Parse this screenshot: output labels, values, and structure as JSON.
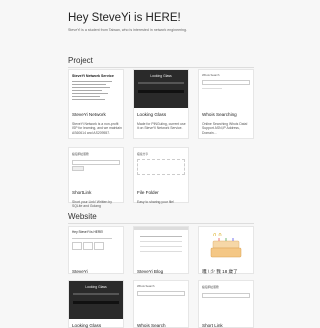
{
  "header": {
    "title": "Hey SteveYi is HERE!",
    "subtitle": "SteveYi is a student from Taiwan, who is interested in network engineering."
  },
  "sections": {
    "project": "Project",
    "website": "Website"
  },
  "projects": [
    {
      "name": "SteveYi Network",
      "desc": "SteveYi Network is a non-profit ISP for learning, and we maintain AS60614 and AS209557.",
      "thumb_title": "SteveYi Network Service"
    },
    {
      "name": "Looking Glass",
      "desc": "Made for PINGuiing, current use it on SteveYi Network Service.",
      "thumb_title": "Looking Glass"
    },
    {
      "name": "Whois Searching",
      "desc": "Online Searching Whois Data! Support ASN,IP Address, Domain...",
      "thumb_title": "Whois Search"
    },
    {
      "name": "ShortLink",
      "desc": "Short your Link! Written by SQLite and Golang",
      "thumb_title": "縮短網址服務"
    },
    {
      "name": "File Folder",
      "desc": "Easy to sharing your file!",
      "thumb_title": "檔案分享"
    }
  ],
  "websites": [
    {
      "name": "SteveYi",
      "thumb_title": "Hey SteveYi is HERE!"
    },
    {
      "name": "SteveYi Blog",
      "thumb_title": ""
    },
    {
      "name": "嘎 \\ 少 我 18 歲了",
      "thumb_title": ""
    },
    {
      "name": "Looking Glass",
      "thumb_title": "Looking Glass"
    },
    {
      "name": "Whois Search",
      "thumb_title": "Whois Search"
    },
    {
      "name": "Short Link",
      "thumb_title": "縮短網址服務"
    }
  ],
  "colors": {
    "background": "#f7f7f7",
    "card": "#ffffff",
    "dark_thumb": "#2a2a2a"
  }
}
